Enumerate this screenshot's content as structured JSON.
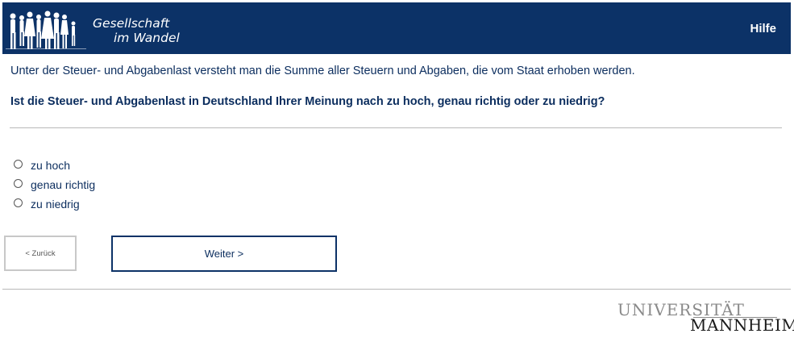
{
  "header": {
    "logo_line1": "Gesellschaft",
    "logo_line2": "im Wandel",
    "help_label": "Hilfe",
    "background_color": "#0c3267"
  },
  "intro_text": "Unter der Steuer- und Abgabenlast versteht man die Summe aller Steuern und Abgaben, die vom Staat erhoben werden.",
  "question_text": "Ist die Steuer- und Abgabenlast in Deutschland Ihrer Meinung nach zu hoch, genau richtig oder zu niedrig?",
  "options": [
    {
      "label": "zu hoch",
      "selected": false
    },
    {
      "label": "genau richtig",
      "selected": false
    },
    {
      "label": "zu niedrig",
      "selected": false
    }
  ],
  "nav": {
    "back_label": "< Zurück",
    "next_label": "Weiter >"
  },
  "footer": {
    "university_line1": "UNIVERSITÄT",
    "university_line2": "MANNHEIM"
  }
}
